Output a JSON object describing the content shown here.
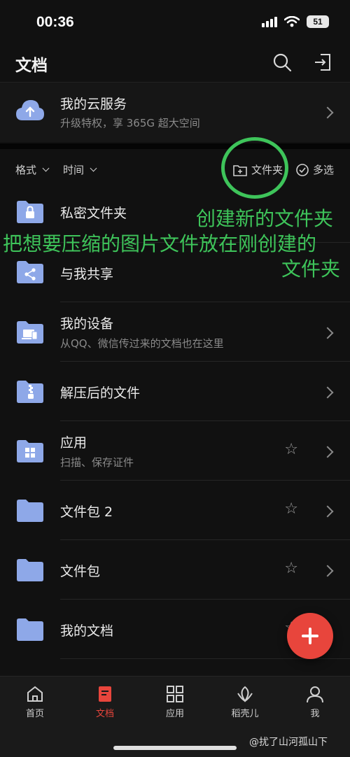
{
  "status_bar": {
    "time": "00:36",
    "battery": "51"
  },
  "header": {
    "title": "文档",
    "icons": [
      "search-icon",
      "exit-icon"
    ]
  },
  "cloud_service": {
    "title": "我的云服务",
    "subtitle": "升级特权，享 365G 超大空间"
  },
  "toolbar": {
    "format_label": "格式",
    "time_label": "时间",
    "new_folder_label": "文件夹",
    "multi_select_label": "多选"
  },
  "folders": [
    {
      "title": "私密文件夹",
      "subtitle": "",
      "icon": "lock-folder-icon",
      "starred": false
    },
    {
      "title": "与我共享",
      "subtitle": "",
      "icon": "share-folder-icon",
      "starred": false
    },
    {
      "title": "我的设备",
      "subtitle": "从QQ、微信传过来的文档也在这里",
      "icon": "device-folder-icon",
      "starred": false
    },
    {
      "title": "解压后的文件",
      "subtitle": "",
      "icon": "zip-folder-icon",
      "starred": false
    },
    {
      "title": "应用",
      "subtitle": "扫描、保存证件",
      "icon": "apps-folder-icon",
      "starred": true
    },
    {
      "title": "文件包 2",
      "subtitle": "",
      "icon": "folder-icon",
      "starred": true
    },
    {
      "title": "文件包",
      "subtitle": "",
      "icon": "folder-icon",
      "starred": true
    },
    {
      "title": "我的文档",
      "subtitle": "",
      "icon": "folder-icon",
      "starred": true
    }
  ],
  "annotation": {
    "line1": "创建新的文件夹",
    "line2": "把想要压缩的图片文件放在刚创建的",
    "line3": "文件夹",
    "color": "#3ec45a"
  },
  "bottom_nav": [
    {
      "label": "首页",
      "icon": "home-icon",
      "active": false
    },
    {
      "label": "文档",
      "icon": "document-icon",
      "active": true
    },
    {
      "label": "应用",
      "icon": "grid-icon",
      "active": false
    },
    {
      "label": "稻壳儿",
      "icon": "leaf-icon",
      "active": false
    },
    {
      "label": "我",
      "icon": "person-icon",
      "active": false
    }
  ],
  "watermark": "@扰了山河孤山下",
  "colors": {
    "accent": "#e8453c",
    "folder": "#8ea8e8",
    "background": "#111111"
  }
}
